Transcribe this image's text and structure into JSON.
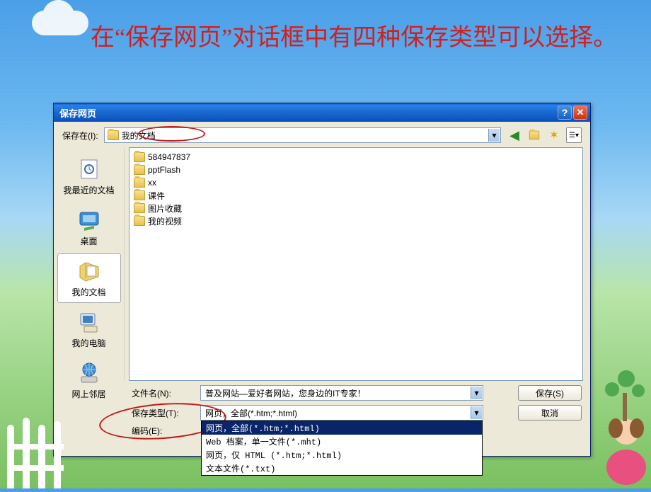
{
  "heading": "在“保存网页”对话框中有四种保存类型可以选择。",
  "dialog": {
    "title": "保存网页",
    "save_in_label": "保存在(I):",
    "save_in_value": "我的文档",
    "filename_label": "文件名(N):",
    "filename_value": "普及网站—爱好者网站，您身边的IT专家！",
    "filetype_label": "保存类型(T):",
    "filetype_value": "网页，全部(*.htm;*.html)",
    "encoding_label": "编码(E):",
    "save_button": "保存(S)",
    "cancel_button": "取消"
  },
  "places": {
    "recent": "我最近的文档",
    "desktop": "桌面",
    "mydocs": "我的文档",
    "mycomputer": "我的电脑",
    "network": "网上邻居"
  },
  "files": [
    "584947837",
    "pptFlash",
    "xx",
    "课件",
    "图片收藏",
    "我的视频"
  ],
  "type_options": [
    "网页，全部(*.htm;*.html)",
    "Web 档案，单一文件(*.mht)",
    "网页，仅 HTML (*.htm;*.html)",
    "文本文件(*.txt)"
  ],
  "icons": {
    "back": "←",
    "up": "↑",
    "new": "✦",
    "view": "☰"
  }
}
